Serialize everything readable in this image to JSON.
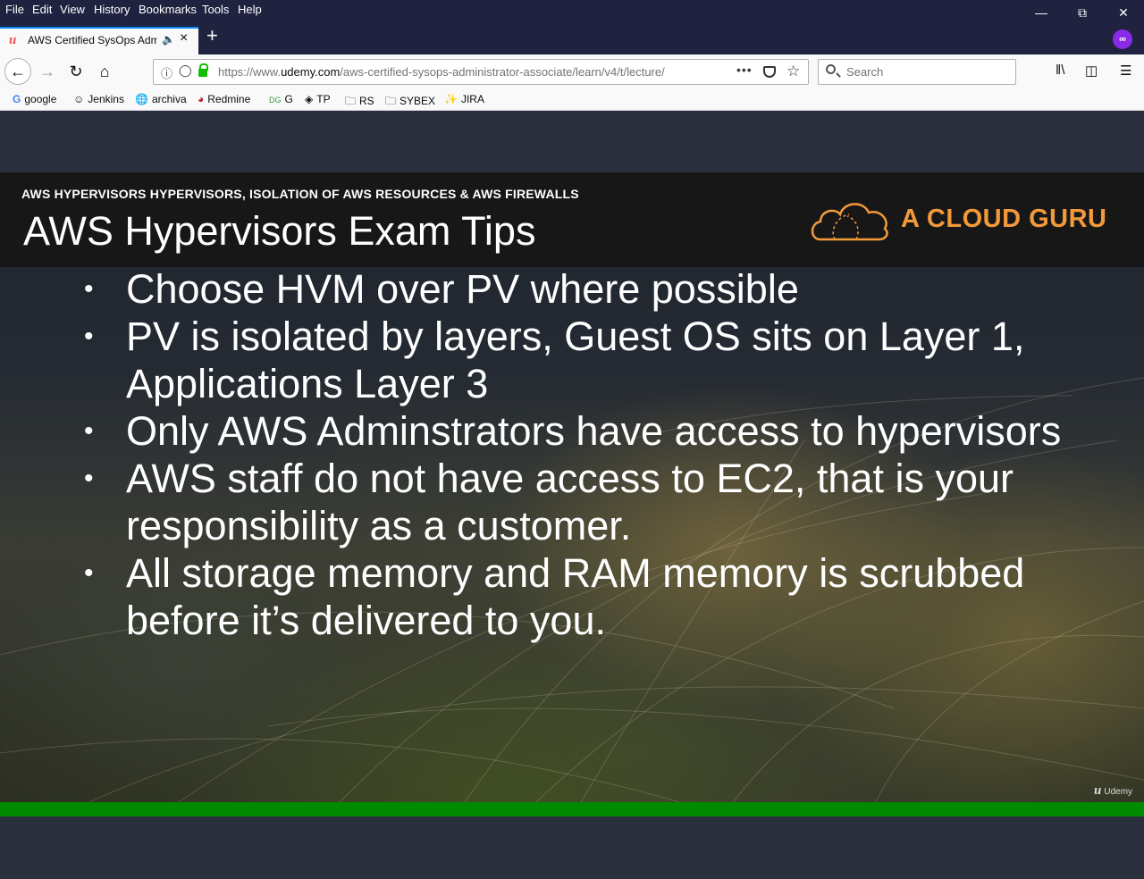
{
  "menubar": {
    "items": [
      "File",
      "Edit",
      "View",
      "History",
      "Bookmarks",
      "Tools",
      "Help"
    ]
  },
  "tab": {
    "title": "AWS Certified SysOps Admini",
    "favicon": "udemy-icon",
    "audio_icon": "speaker-icon",
    "close_icon": "close-icon"
  },
  "newtab": {
    "icon": "plus-icon"
  },
  "navbar": {
    "url_prefix": "https://www.",
    "url_domain": "udemy.com",
    "url_path": "/aws-certified-sysops-administrator-associate/learn/v4/t/lecture/",
    "search_placeholder": "Search"
  },
  "bookmarks": [
    {
      "label": "google",
      "icon": "google-icon"
    },
    {
      "label": "Jenkins",
      "icon": "jenkins-icon"
    },
    {
      "label": "archiva",
      "icon": "globe-icon"
    },
    {
      "label": "Redmine",
      "icon": "redmine-icon"
    },
    {
      "label": "G",
      "icon": "dg-icon"
    },
    {
      "label": "TP",
      "icon": "diamond-icon"
    },
    {
      "label": "RS",
      "icon": "folder-icon"
    },
    {
      "label": "SYBEX",
      "icon": "folder-icon"
    },
    {
      "label": "JIRA",
      "icon": "jira-icon"
    }
  ],
  "slide": {
    "subtitle": "AWS HYPERVISORS HYPERVISORS, ISOLATION OF AWS RESOURCES & AWS FIREWALLS",
    "title": "AWS Hypervisors Exam Tips",
    "brand": "A CLOUD GURU",
    "bullets": [
      "Choose HVM over PV where possible",
      "PV is isolated by layers, Guest OS sits on Layer 1, Applications Layer 3",
      "Only AWS Adminstrators have access to hypervisors",
      "AWS staff do not have access to EC2, that is your responsibility as a customer.",
      "All storage memory and RAM memory is scrubbed before it’s delivered to you."
    ],
    "watermark": "Udemy"
  },
  "colors": {
    "chrome_dark": "#202340",
    "brand_orange": "#f29a3a",
    "progress_green": "#008a00",
    "accent_blue": "#0a84ff"
  },
  "progress": {
    "fraction": 1.0
  }
}
